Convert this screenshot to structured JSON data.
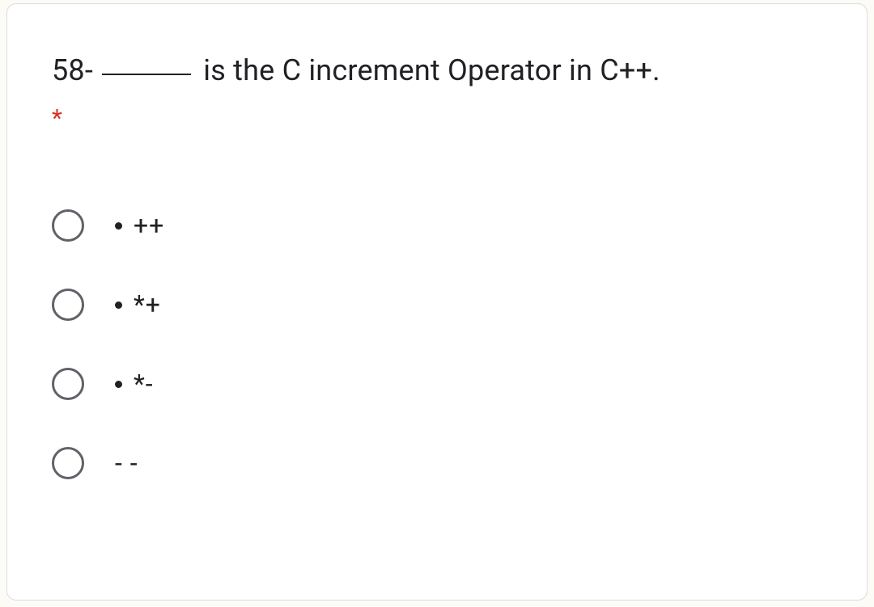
{
  "question": {
    "prefix": "58- ",
    "suffix": " is the C increment Operator in C++.",
    "required_marker": "*"
  },
  "options": [
    {
      "label": "++",
      "has_bullet": true
    },
    {
      "label": "*+",
      "has_bullet": true
    },
    {
      "label": "*-",
      "has_bullet": true
    },
    {
      "label": "- -",
      "has_bullet": false
    }
  ]
}
